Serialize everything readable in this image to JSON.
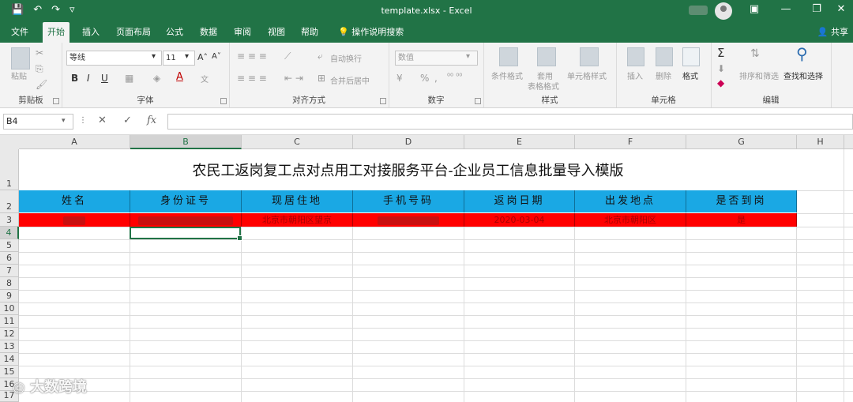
{
  "window": {
    "document_title": "template.xlsx - Excel",
    "qat": [
      "💾",
      "↶",
      "↷",
      "▿"
    ],
    "buttons": [
      "▣",
      "—",
      "❐",
      "✕"
    ]
  },
  "tabs": [
    "文件",
    "开始",
    "插入",
    "页面布局",
    "公式",
    "数据",
    "审阅",
    "视图",
    "帮助"
  ],
  "tell_me": "操作说明搜索",
  "share": "共享",
  "ribbon": {
    "clipboard": {
      "paste": "粘贴",
      "label": "剪贴板"
    },
    "font": {
      "name": "等线",
      "size": "11",
      "grow": "A˄",
      "shrink": "A˅",
      "bold": "B",
      "italic": "I",
      "underline": "U",
      "label": "字体"
    },
    "alignment": {
      "wrap": "自动换行",
      "merge": "合并后居中",
      "label": "对齐方式"
    },
    "number": {
      "format": "数值",
      "percent": "%",
      "comma": ",",
      "label": "数字"
    },
    "styles": {
      "conditional": "条件格式",
      "table_1": "套用",
      "table_2": "表格格式",
      "cell_styles": "单元格样式",
      "label": "样式"
    },
    "cells": {
      "insert": "插入",
      "delete": "删除",
      "format": "格式",
      "label": "单元格"
    },
    "editing": {
      "sum": "Σ",
      "sort": "排序和筛选",
      "find": "查找和选择",
      "label": "编辑"
    }
  },
  "formula_bar": {
    "name_box": "B4",
    "cancel": "✕",
    "enter": "✓",
    "fx": "fx",
    "value": ""
  },
  "columns": [
    "A",
    "B",
    "C",
    "D",
    "E",
    "F",
    "G",
    "H"
  ],
  "selected_column": "B",
  "rows": [
    "1",
    "2",
    "3",
    "4",
    "5",
    "6",
    "7",
    "8",
    "9",
    "10",
    "11",
    "12",
    "13",
    "14",
    "15",
    "16",
    "17"
  ],
  "selected_row": "4",
  "sheet": {
    "title": "农民工返岗复工点对点用工对接服务平台-企业员工信息批量导入模版",
    "headers": [
      "姓名",
      "身份证号",
      "现居住地",
      "手机号码",
      "返岗日期",
      "出发地点",
      "是否到岗"
    ],
    "row3": [
      "",
      "",
      "北京市朝阳区望京",
      "",
      "2020-03-04",
      "北京市朝阳区",
      "是"
    ]
  },
  "colors": {
    "excel_green": "#217346",
    "header_fill": "#1aa8e4",
    "row_fill": "#ff0000"
  },
  "watermark": "大数跨境"
}
